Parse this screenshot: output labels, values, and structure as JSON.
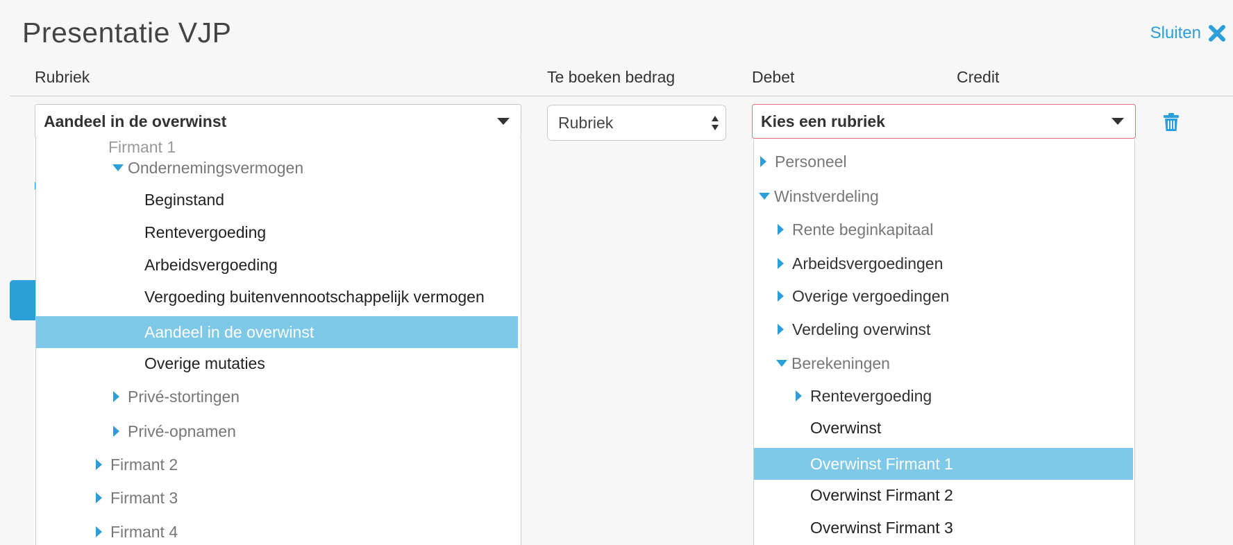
{
  "modal": {
    "title": "Presentatie VJP",
    "close_label": "Sluiten"
  },
  "columns": {
    "rubriek": "Rubriek",
    "bedrag": "Te boeken bedrag",
    "debet": "Debet",
    "credit": "Credit"
  },
  "row": {
    "rubriek_select": {
      "value": "Aandeel in de overwinst"
    },
    "bedrag_stepper": {
      "value": "Rubriek"
    },
    "debet_select": {
      "value": "Kies een rubriek",
      "state": "invalid"
    }
  },
  "rubriek_tree": [
    {
      "label": "Firmant 1",
      "type": "group",
      "expanded": true
    },
    {
      "label": "Ondernemingsvermogen",
      "type": "group",
      "expanded": true
    },
    {
      "label": "Beginstand",
      "type": "leaf"
    },
    {
      "label": "Rentevergoeding",
      "type": "leaf"
    },
    {
      "label": "Arbeidsvergoeding",
      "type": "leaf"
    },
    {
      "label": "Vergoeding buitenvennootschappelijk vermogen",
      "type": "leaf"
    },
    {
      "label": "Aandeel in de overwinst",
      "type": "leaf",
      "selected": true
    },
    {
      "label": "Overige mutaties",
      "type": "leaf"
    },
    {
      "label": "Privé-stortingen",
      "type": "group",
      "expanded": false
    },
    {
      "label": "Privé-opnamen",
      "type": "group",
      "expanded": false
    },
    {
      "label": "Firmant 2",
      "type": "group",
      "expanded": false
    },
    {
      "label": "Firmant 3",
      "type": "group",
      "expanded": false
    },
    {
      "label": "Firmant 4",
      "type": "group",
      "expanded": false
    }
  ],
  "debet_tree": [
    {
      "label": "Personeel",
      "type": "group",
      "expanded": false
    },
    {
      "label": "Winstverdeling",
      "type": "group",
      "expanded": true
    },
    {
      "label": "Rente beginkapitaal",
      "type": "group",
      "expanded": false
    },
    {
      "label": "Arbeidsvergoedingen",
      "type": "group",
      "expanded": false
    },
    {
      "label": "Overige vergoedingen",
      "type": "group",
      "expanded": false
    },
    {
      "label": "Verdeling overwinst",
      "type": "group",
      "expanded": false
    },
    {
      "label": "Berekeningen",
      "type": "group",
      "expanded": true
    },
    {
      "label": "Rentevergoeding",
      "type": "group",
      "expanded": false
    },
    {
      "label": "Overwinst",
      "type": "leaf"
    },
    {
      "label": "Overwinst Firmant 1",
      "type": "leaf",
      "selected": true
    },
    {
      "label": "Overwinst Firmant 2",
      "type": "leaf"
    },
    {
      "label": "Overwinst Firmant 3",
      "type": "leaf"
    }
  ],
  "colors": {
    "accent": "#2a9fd8",
    "selected_bg": "#7ec8e8",
    "invalid_border": "#e0707a"
  },
  "icons": {
    "close": "close-icon",
    "delete": "trash-icon",
    "expand": "caret-right-icon",
    "collapse": "caret-down-icon"
  }
}
